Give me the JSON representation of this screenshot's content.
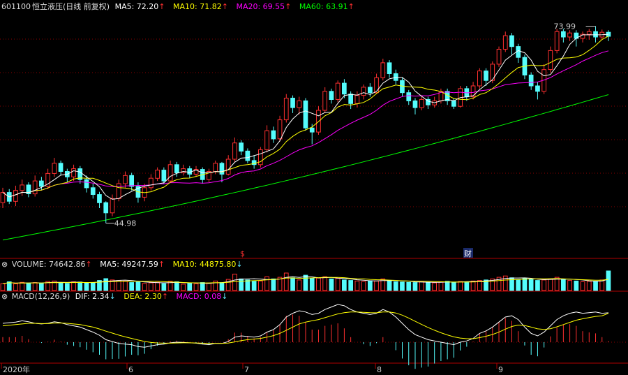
{
  "header": {
    "code": "601100",
    "name": "恒立液压",
    "mode": "(日线 前复权)",
    "ma": [
      {
        "label": "MA5: 72.20",
        "color": "#ffffff",
        "trend": "up"
      },
      {
        "label": "MA10: 71.82",
        "color": "#ffff00",
        "trend": "up"
      },
      {
        "label": "MA20: 69.55",
        "color": "#ff00ff",
        "trend": "up"
      },
      {
        "label": "MA60: 63.91",
        "color": "#00ff00",
        "trend": "up"
      }
    ]
  },
  "volume_header": {
    "label": "VOLUME: 74642.86",
    "label_trend": "up",
    "ma5": "MA5: 49247.59",
    "ma5_trend": "up",
    "ma10": "MA10: 44875.80",
    "ma10_trend": "down"
  },
  "macd_header": {
    "label": "MACD(12,26,9)",
    "dif": "DIF: 2.34",
    "dif_trend": "down",
    "dea": "DEA: 2.30",
    "dea_trend": "up",
    "macd": "MACD: 0.08",
    "macd_trend": "down"
  },
  "annotations": {
    "high": "73.99",
    "low": "44.98",
    "event1": "$",
    "event2": "财"
  },
  "x_axis_labels": [
    "2020年",
    "6",
    "7",
    "8",
    "9"
  ],
  "colors": {
    "up": "#ff3030",
    "down": "#54fcfc",
    "ma5": "#ffffff",
    "ma10": "#ffff00",
    "ma20": "#ff00ff",
    "ma60": "#00ff00",
    "grid": "#8b0000",
    "axis": "#b00000"
  },
  "chart_data": {
    "type": "candlestick",
    "price_range": [
      40,
      76
    ],
    "ma60_start": 42.5,
    "ma60_end": 63.91,
    "candles": [
      [
        48.0,
        49.5,
        47.2,
        50.2
      ],
      [
        49.5,
        48.2,
        47.8,
        50.0
      ],
      [
        48.2,
        49.8,
        47.5,
        50.5
      ],
      [
        49.8,
        50.6,
        49.0,
        51.4
      ],
      [
        50.6,
        49.3,
        48.8,
        51.0
      ],
      [
        49.3,
        51.2,
        48.9,
        52.0
      ],
      [
        51.2,
        50.4,
        49.8,
        51.8
      ],
      [
        50.4,
        52.3,
        50.0,
        53.0
      ],
      [
        52.3,
        53.8,
        51.8,
        54.6
      ],
      [
        53.8,
        52.6,
        52.0,
        54.2
      ],
      [
        52.6,
        51.8,
        51.0,
        53.0
      ],
      [
        51.8,
        53.0,
        51.2,
        53.6
      ],
      [
        53.0,
        51.4,
        50.8,
        53.4
      ],
      [
        51.4,
        50.2,
        49.5,
        52.0
      ],
      [
        50.2,
        49.2,
        48.6,
        50.8
      ],
      [
        49.2,
        48.0,
        47.2,
        49.6
      ],
      [
        48.0,
        46.5,
        44.98,
        48.2
      ],
      [
        46.5,
        48.6,
        46.0,
        49.2
      ],
      [
        48.6,
        50.8,
        48.2,
        51.4
      ],
      [
        50.8,
        52.0,
        50.2,
        52.6
      ],
      [
        52.0,
        50.4,
        49.8,
        52.4
      ],
      [
        50.4,
        48.8,
        48.0,
        51.0
      ],
      [
        48.8,
        50.2,
        48.2,
        50.8
      ],
      [
        50.2,
        51.6,
        49.8,
        52.2
      ],
      [
        51.6,
        52.8,
        51.2,
        53.2
      ],
      [
        52.8,
        51.2,
        50.8,
        53.2
      ],
      [
        51.2,
        53.6,
        51.0,
        54.2
      ],
      [
        53.6,
        52.4,
        51.8,
        54.0
      ],
      [
        52.4,
        53.0,
        52.0,
        53.6
      ],
      [
        53.0,
        52.2,
        51.6,
        53.4
      ],
      [
        52.2,
        52.9,
        51.8,
        53.4
      ],
      [
        52.9,
        51.4,
        50.8,
        53.2
      ],
      [
        51.4,
        52.6,
        51.0,
        53.0
      ],
      [
        52.6,
        53.8,
        52.2,
        54.2
      ],
      [
        53.8,
        52.2,
        51.0,
        54.0
      ],
      [
        52.2,
        54.4,
        52.0,
        55.0
      ],
      [
        54.4,
        56.8,
        54.0,
        57.6
      ],
      [
        56.8,
        55.6,
        55.0,
        57.2
      ],
      [
        55.6,
        54.2,
        53.8,
        56.0
      ],
      [
        54.2,
        53.6,
        53.0,
        55.0
      ],
      [
        53.6,
        55.8,
        53.2,
        56.2
      ],
      [
        55.8,
        58.6,
        55.4,
        59.4
      ],
      [
        58.6,
        57.4,
        56.8,
        59.2
      ],
      [
        57.4,
        60.2,
        57.0,
        60.8
      ],
      [
        60.2,
        63.4,
        59.8,
        64.0
      ],
      [
        63.4,
        62.0,
        61.2,
        63.8
      ],
      [
        62.0,
        63.0,
        61.0,
        63.6
      ],
      [
        63.0,
        59.0,
        58.6,
        63.4
      ],
      [
        59.0,
        58.4,
        56.6,
        59.6
      ],
      [
        58.4,
        61.6,
        58.0,
        62.2
      ],
      [
        61.6,
        64.4,
        61.2,
        65.0
      ],
      [
        64.4,
        63.2,
        62.6,
        64.8
      ],
      [
        63.2,
        65.6,
        62.8,
        66.0
      ],
      [
        65.6,
        64.0,
        63.4,
        66.2
      ],
      [
        64.0,
        62.6,
        61.8,
        64.4
      ],
      [
        62.6,
        63.8,
        62.0,
        64.4
      ],
      [
        63.8,
        65.0,
        63.2,
        65.4
      ],
      [
        65.0,
        64.2,
        63.6,
        65.6
      ],
      [
        64.2,
        66.4,
        64.0,
        67.0
      ],
      [
        66.4,
        68.6,
        66.0,
        69.2
      ],
      [
        68.6,
        67.0,
        66.4,
        69.0
      ],
      [
        67.0,
        66.0,
        65.4,
        67.6
      ],
      [
        66.0,
        64.2,
        63.6,
        66.4
      ],
      [
        64.2,
        63.0,
        62.4,
        64.6
      ],
      [
        63.0,
        62.0,
        61.0,
        63.4
      ],
      [
        62.0,
        63.2,
        61.6,
        63.8
      ],
      [
        63.2,
        62.4,
        61.8,
        63.6
      ],
      [
        62.4,
        63.0,
        62.0,
        63.6
      ],
      [
        63.0,
        64.4,
        62.6,
        64.8
      ],
      [
        64.4,
        63.0,
        62.4,
        64.8
      ],
      [
        63.0,
        62.2,
        61.8,
        63.4
      ],
      [
        62.2,
        64.8,
        62.0,
        65.2
      ],
      [
        64.8,
        63.6,
        63.0,
        65.2
      ],
      [
        63.6,
        65.2,
        63.2,
        65.8
      ],
      [
        65.2,
        67.4,
        64.8,
        67.8
      ],
      [
        67.4,
        66.0,
        65.2,
        67.8
      ],
      [
        66.0,
        68.4,
        65.6,
        68.8
      ],
      [
        68.4,
        70.6,
        68.0,
        71.0
      ],
      [
        70.6,
        72.6,
        70.2,
        73.2
      ],
      [
        72.6,
        71.0,
        69.8,
        73.0
      ],
      [
        71.0,
        69.4,
        68.6,
        71.4
      ],
      [
        69.4,
        66.8,
        66.2,
        69.8
      ],
      [
        66.8,
        65.2,
        64.6,
        67.2
      ],
      [
        65.2,
        64.4,
        63.2,
        65.8
      ],
      [
        64.4,
        67.6,
        64.0,
        68.4
      ],
      [
        67.6,
        70.4,
        67.2,
        71.0
      ],
      [
        70.4,
        73.2,
        70.0,
        73.6
      ],
      [
        73.2,
        72.4,
        71.6,
        73.6
      ],
      [
        72.4,
        73.0,
        71.8,
        73.4
      ],
      [
        73.0,
        72.2,
        71.0,
        73.4
      ],
      [
        72.2,
        72.8,
        71.6,
        73.2
      ],
      [
        72.8,
        73.2,
        72.0,
        73.6
      ],
      [
        73.2,
        72.4,
        71.6,
        73.99
      ],
      [
        72.4,
        73.1,
        72.0,
        73.5
      ],
      [
        73.1,
        72.5,
        71.8,
        73.4
      ]
    ],
    "volume": [
      26,
      33,
      25,
      31,
      28,
      30,
      27,
      34,
      36,
      29,
      27,
      33,
      32,
      28,
      30,
      38,
      45,
      40,
      38,
      36,
      30,
      32,
      27,
      29,
      31,
      26,
      35,
      33,
      24,
      27,
      25,
      30,
      28,
      36,
      30,
      42,
      62,
      44,
      40,
      35,
      36,
      52,
      44,
      50,
      66,
      48,
      40,
      58,
      46,
      47,
      52,
      44,
      46,
      40,
      38,
      36,
      34,
      37,
      36,
      44,
      38,
      33,
      32,
      31,
      30,
      34,
      30,
      29,
      33,
      35,
      32,
      34,
      33,
      36,
      38,
      40,
      44,
      50,
      55,
      48,
      40,
      46,
      42,
      38,
      40,
      44,
      50,
      42,
      38,
      36,
      33,
      35,
      34,
      40,
      74
    ],
    "macd": {
      "dif": [
        1.5,
        1.55,
        1.6,
        1.7,
        1.62,
        1.5,
        1.45,
        1.5,
        1.62,
        1.55,
        1.4,
        1.3,
        1.2,
        1.0,
        0.8,
        0.55,
        0.2,
        0.05,
        -0.1,
        -0.15,
        -0.2,
        -0.35,
        -0.4,
        -0.3,
        -0.2,
        -0.15,
        -0.05,
        0.0,
        -0.02,
        -0.05,
        -0.08,
        -0.15,
        -0.2,
        -0.1,
        -0.1,
        0.05,
        0.4,
        0.5,
        0.45,
        0.4,
        0.5,
        0.8,
        1.0,
        1.4,
        2.0,
        2.3,
        2.5,
        2.4,
        2.2,
        2.3,
        2.6,
        2.8,
        3.0,
        2.9,
        2.6,
        2.4,
        2.3,
        2.2,
        2.3,
        2.6,
        2.4,
        2.0,
        1.5,
        1.0,
        0.6,
        0.4,
        0.2,
        0.1,
        0.0,
        -0.1,
        -0.2,
        0.0,
        0.1,
        0.3,
        0.7,
        0.9,
        1.2,
        1.6,
        2.0,
        2.1,
        1.8,
        1.2,
        0.7,
        0.5,
        0.8,
        1.3,
        1.8,
        2.1,
        2.3,
        2.4,
        2.3,
        2.35,
        2.4,
        2.3,
        2.34
      ],
      "dea": [
        1.3,
        1.35,
        1.4,
        1.45,
        1.5,
        1.5,
        1.48,
        1.48,
        1.52,
        1.53,
        1.5,
        1.45,
        1.4,
        1.3,
        1.2,
        1.05,
        0.88,
        0.72,
        0.56,
        0.42,
        0.3,
        0.17,
        0.06,
        -0.02,
        -0.06,
        -0.08,
        -0.08,
        -0.06,
        -0.05,
        -0.05,
        -0.06,
        -0.08,
        -0.1,
        -0.1,
        -0.1,
        -0.07,
        0.02,
        0.12,
        0.2,
        0.25,
        0.3,
        0.4,
        0.52,
        0.7,
        0.95,
        1.2,
        1.45,
        1.6,
        1.7,
        1.8,
        1.95,
        2.1,
        2.25,
        2.35,
        2.4,
        2.4,
        2.38,
        2.35,
        2.34,
        2.4,
        2.4,
        2.32,
        2.15,
        1.92,
        1.66,
        1.41,
        1.17,
        0.95,
        0.75,
        0.58,
        0.42,
        0.33,
        0.28,
        0.28,
        0.36,
        0.47,
        0.61,
        0.8,
        1.04,
        1.25,
        1.36,
        1.33,
        1.2,
        1.06,
        1.01,
        1.07,
        1.22,
        1.4,
        1.58,
        1.75,
        1.86,
        1.96,
        2.05,
        2.1,
        2.3
      ]
    }
  }
}
